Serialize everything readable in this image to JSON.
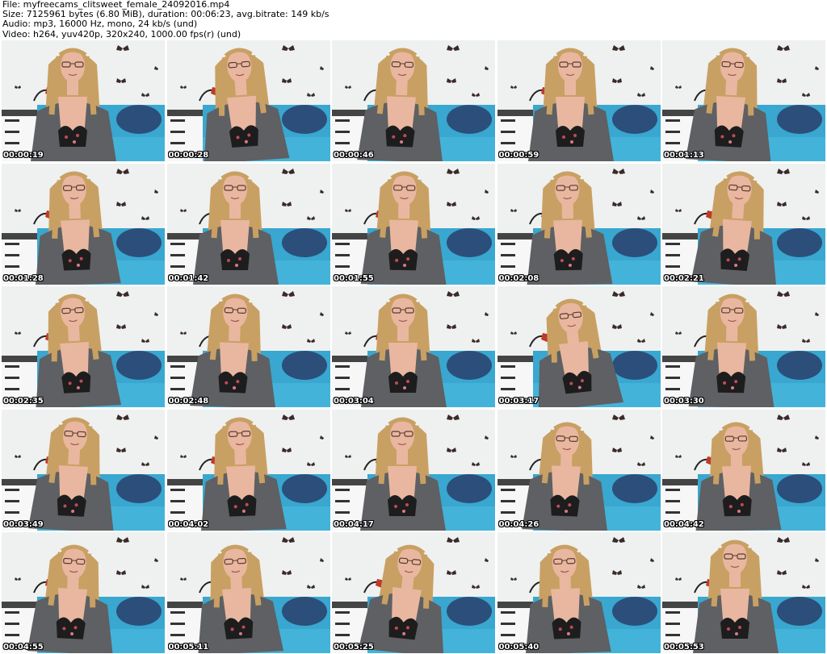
{
  "header": {
    "file": "File: myfreecams_clitsweet_female_24092016.mp4",
    "size": "Size: 7125961 bytes (6.80 MiB), duration: 00:06:23, avg.bitrate: 149 kb/s",
    "audio": "Audio: mp3, 16000 Hz, mono, 24 kb/s (und)",
    "video": "Video: h264, yuv420p, 320x240, 1000.00 fps(r) (und)"
  },
  "colors": {
    "wall": "#eef1ef",
    "bed": "#39a7cf",
    "pillow": "#2b4f7a",
    "hair": "#c9a063",
    "skin": "#e9b7a0",
    "cardigan": "#5e6063",
    "butterfly": "#3a2a2a",
    "lamp_shade": "#c0392b",
    "dresser": "#f7f7f7",
    "timestamp_text": "#ffffff"
  },
  "thumbnails": [
    {
      "timestamp": "00:00:19",
      "icon": "webcam-frame"
    },
    {
      "timestamp": "00:00:28",
      "icon": "webcam-frame"
    },
    {
      "timestamp": "00:00:46",
      "icon": "webcam-frame"
    },
    {
      "timestamp": "00:00:59",
      "icon": "webcam-frame"
    },
    {
      "timestamp": "00:01:13",
      "icon": "webcam-frame"
    },
    {
      "timestamp": "00:01:28",
      "icon": "webcam-frame"
    },
    {
      "timestamp": "00:01:42",
      "icon": "webcam-frame"
    },
    {
      "timestamp": "00:01:55",
      "icon": "webcam-frame"
    },
    {
      "timestamp": "00:02:08",
      "icon": "webcam-frame"
    },
    {
      "timestamp": "00:02:21",
      "icon": "webcam-frame"
    },
    {
      "timestamp": "00:02:35",
      "icon": "webcam-frame"
    },
    {
      "timestamp": "00:02:48",
      "icon": "webcam-frame"
    },
    {
      "timestamp": "00:03:04",
      "icon": "webcam-frame"
    },
    {
      "timestamp": "00:03:17",
      "icon": "webcam-frame"
    },
    {
      "timestamp": "00:03:30",
      "icon": "webcam-frame"
    },
    {
      "timestamp": "00:03:49",
      "icon": "webcam-frame"
    },
    {
      "timestamp": "00:04:02",
      "icon": "webcam-frame"
    },
    {
      "timestamp": "00:04:17",
      "icon": "webcam-frame"
    },
    {
      "timestamp": "00:04:26",
      "icon": "webcam-frame"
    },
    {
      "timestamp": "00:04:42",
      "icon": "webcam-frame"
    },
    {
      "timestamp": "00:04:55",
      "icon": "webcam-frame"
    },
    {
      "timestamp": "00:05:11",
      "icon": "webcam-frame"
    },
    {
      "timestamp": "00:05:25",
      "icon": "webcam-frame"
    },
    {
      "timestamp": "00:05:40",
      "icon": "webcam-frame"
    },
    {
      "timestamp": "00:05:53",
      "icon": "webcam-frame"
    }
  ]
}
